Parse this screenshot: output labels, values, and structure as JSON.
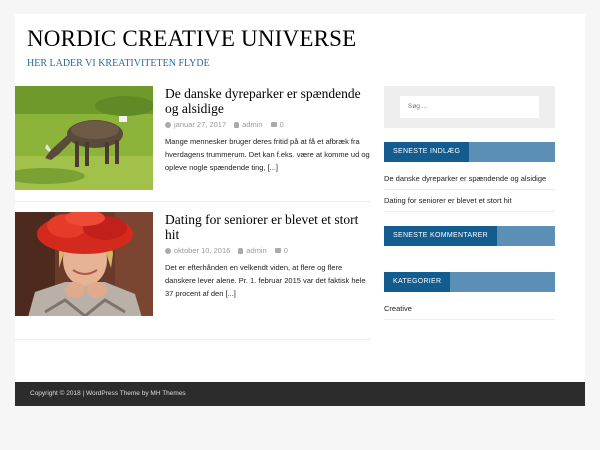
{
  "site": {
    "title": "NORDIC CREATIVE UNIVERSE",
    "tagline": "HER LADER VI KREATIVITETEN FLYDE"
  },
  "posts": [
    {
      "title": "De danske dyreparker er spændende og alsidige",
      "date": "januar 27, 2017",
      "author": "admin",
      "comments": "0",
      "excerpt": "Mange mennesker bruger deres fritid på at få et afbræk fra hverdagens trummerum. Det kan f.eks. være at komme ud og opleve nogle spændende ting, [...]",
      "thumb": "goat-photo"
    },
    {
      "title": "Dating for seniorer er blevet et stort hit",
      "date": "oktober 10, 2016",
      "author": "admin",
      "comments": "0",
      "excerpt": "Det er efterhånden en velkendt viden, at flere og flere danskere lever alene. Pr. 1. februar 2015 var det faktisk hele 37 procent af den [...]",
      "thumb": "woman-red-hat-photo"
    }
  ],
  "sidebar": {
    "search_placeholder": "Søg ...",
    "recent_posts_title": "SENESTE INDLÆG",
    "recent_posts": [
      "De danske dyreparker er spændende og alsidige",
      "Dating for seniorer er blevet et stort hit"
    ],
    "recent_comments_title": "SENESTE KOMMENTARER",
    "categories_title": "KATEGORIER",
    "categories": [
      "Creative"
    ]
  },
  "footer": {
    "text": "Copyright © 2018 | WordPress Theme by MH Themes"
  },
  "colors": {
    "accent_dark": "#135c8f",
    "accent_light": "#5b8fb5",
    "footer_bg": "#2c2c2c"
  }
}
